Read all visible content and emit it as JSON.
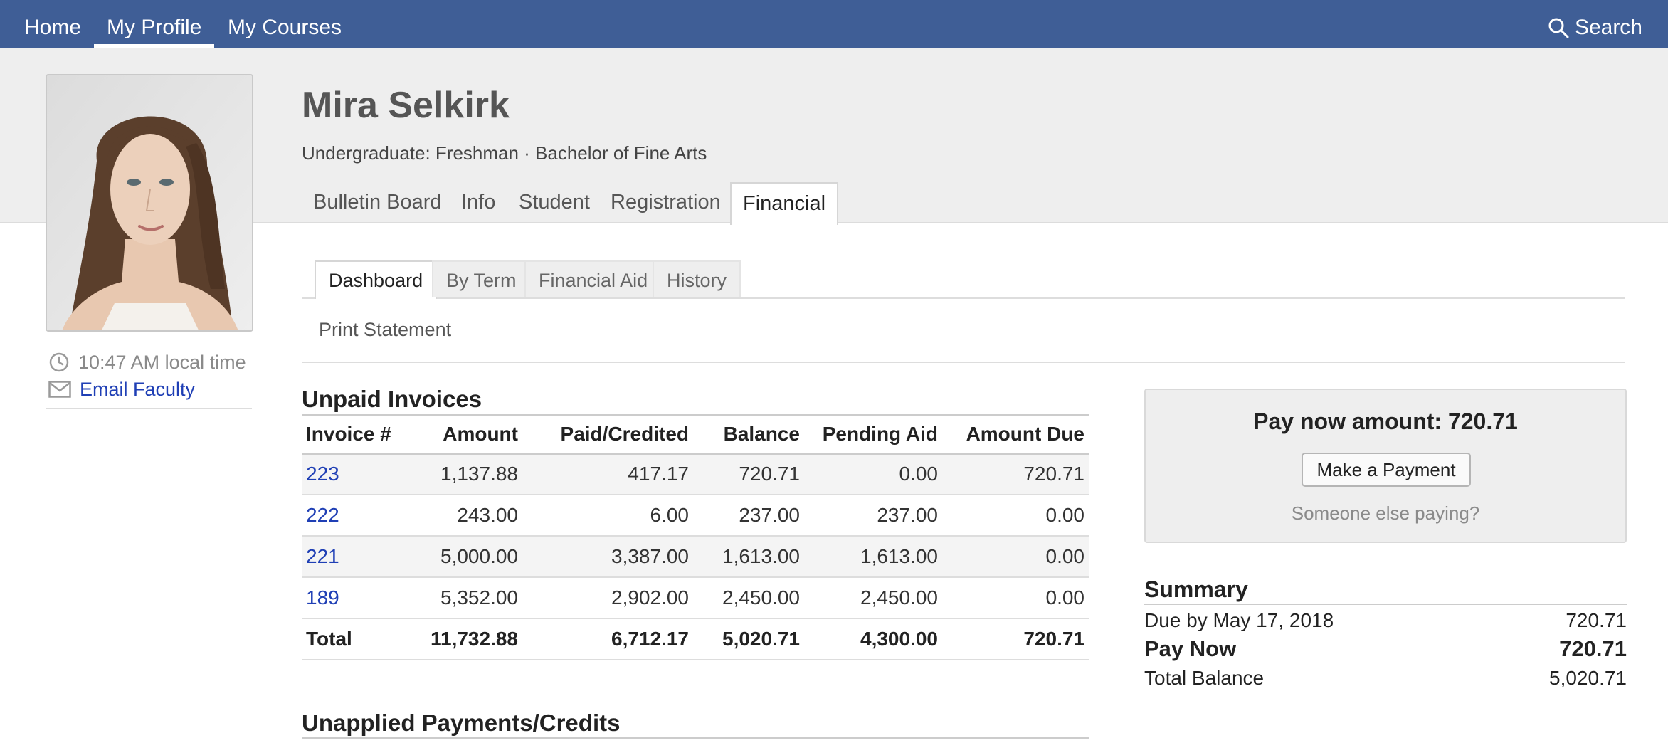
{
  "topnav": {
    "items": [
      {
        "label": "Home"
      },
      {
        "label": "My Profile"
      },
      {
        "label": "My Courses"
      }
    ],
    "search_label": "Search"
  },
  "profile": {
    "name": "Mira Selkirk",
    "subtitle": "Undergraduate: Freshman · Bachelor of Fine Arts",
    "local_time": "10:47 AM local time",
    "email_link": "Email Faculty"
  },
  "profile_tabs": [
    {
      "label": "Bulletin Board"
    },
    {
      "label": "Info"
    },
    {
      "label": "Student"
    },
    {
      "label": "Registration"
    },
    {
      "label": "Financial"
    }
  ],
  "financial_tabs": [
    {
      "label": "Dashboard"
    },
    {
      "label": "By Term"
    },
    {
      "label": "Financial Aid"
    },
    {
      "label": "History"
    }
  ],
  "print_statement": "Print Statement",
  "invoices": {
    "title": "Unpaid Invoices",
    "headers": [
      "Invoice #",
      "Amount",
      "Paid/Credited",
      "Balance",
      "Pending Aid",
      "Amount Due"
    ],
    "rows": [
      [
        "223",
        "1,137.88",
        "417.17",
        "720.71",
        "0.00",
        "720.71"
      ],
      [
        "222",
        "243.00",
        "6.00",
        "237.00",
        "237.00",
        "0.00"
      ],
      [
        "221",
        "5,000.00",
        "3,387.00",
        "1,613.00",
        "1,613.00",
        "0.00"
      ],
      [
        "189",
        "5,352.00",
        "2,902.00",
        "2,450.00",
        "2,450.00",
        "0.00"
      ]
    ],
    "total": [
      "Total",
      "11,732.88",
      "6,712.17",
      "5,020.71",
      "4,300.00",
      "720.71"
    ]
  },
  "unapplied_title": "Unapplied Payments/Credits",
  "pay_panel": {
    "amount_text": "Pay now amount: 720.71",
    "button_label": "Make a Payment",
    "someone_else": "Someone else paying?"
  },
  "summary": {
    "title": "Summary",
    "rows": [
      {
        "label": "Due by May 17, 2018",
        "value": "720.71"
      },
      {
        "label": "Pay Now",
        "value": "720.71"
      },
      {
        "label": "Total Balance",
        "value": "5,020.71"
      }
    ]
  },
  "colors": {
    "nav_bg": "#3f5e96",
    "link": "#1f3fb5",
    "header_bg": "#eeeeee"
  }
}
